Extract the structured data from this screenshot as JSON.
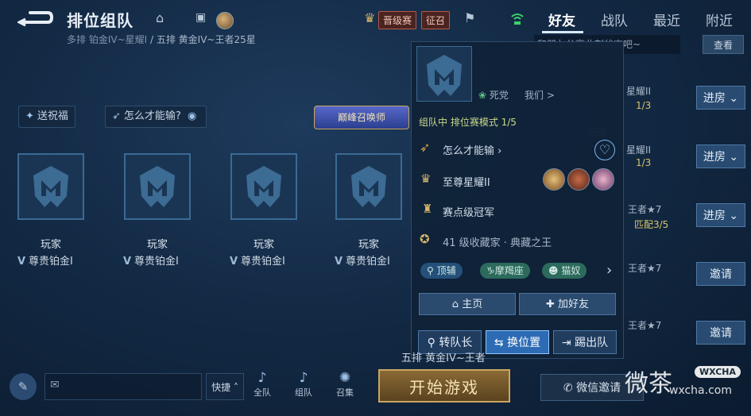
{
  "header": {
    "title": "排位组队",
    "subtitle_left": "多排  铂金IV~星耀I",
    "subtitle_right": " / 五排 黄金IV~王者25星",
    "promo_label": "晋级赛",
    "recruit_label": "征召"
  },
  "tabs": [
    {
      "label": "好友",
      "active": true
    },
    {
      "label": "战队",
      "active": false
    },
    {
      "label": "最近",
      "active": false
    },
    {
      "label": "附近",
      "active": false
    }
  ],
  "lobby": {
    "bless_button": "送祝福",
    "how_to_win_button": "怎么才能输?",
    "banner_label": "巅峰召唤师",
    "slots": [
      {
        "name": "玩家",
        "rank": "尊贵铂金I"
      },
      {
        "name": "玩家",
        "rank": "尊贵铂金I"
      },
      {
        "name": "玩家",
        "rank": "尊贵铂金I"
      },
      {
        "name": "玩家",
        "rank": "尊贵铂金I"
      }
    ]
  },
  "popup": {
    "tag_dead": "死党",
    "tag_us": "我们 >",
    "status": "组队中  排位赛模式 1/5",
    "motto": "怎么才能输",
    "rank": "至尊星耀II",
    "title": "赛点级冠军",
    "collector": "41 级收藏家 · 典藏之王",
    "tags": [
      "顶辅",
      "摩羯座",
      "猫奴"
    ],
    "home_button": "主页",
    "add_friend_button": "加好友"
  },
  "actions": {
    "transfer_leader": "转队长",
    "swap_position": "换位置",
    "kick": "踢出队"
  },
  "friends_panel": {
    "share_placeholder": "和朋友分享此刻状态吧~",
    "view_button": "查看",
    "rows": [
      {
        "text1": "星耀II",
        "text2": "1/3",
        "button": "进房"
      },
      {
        "text1": "星耀II",
        "text2": "1/3",
        "button": "进房"
      },
      {
        "text1": "王者★7",
        "text2": "匹配3/5",
        "button": "进房"
      },
      {
        "text1": "王者★7",
        "text2": "",
        "button": "邀请"
      },
      {
        "text1": "王者★7",
        "text2": "",
        "button": "邀请"
      }
    ],
    "player_label": "玩家",
    "team_text": "五排 黄金IV~王者"
  },
  "bottom": {
    "quick_label": "快捷",
    "all_team": "全队",
    "team": "组队",
    "summon": "召集",
    "start_button": "开始游戏",
    "wechat_invite": "微信邀请"
  },
  "watermark": {
    "text": "微茶",
    "tag": "WXCHA",
    "url": "wxcha.com"
  }
}
